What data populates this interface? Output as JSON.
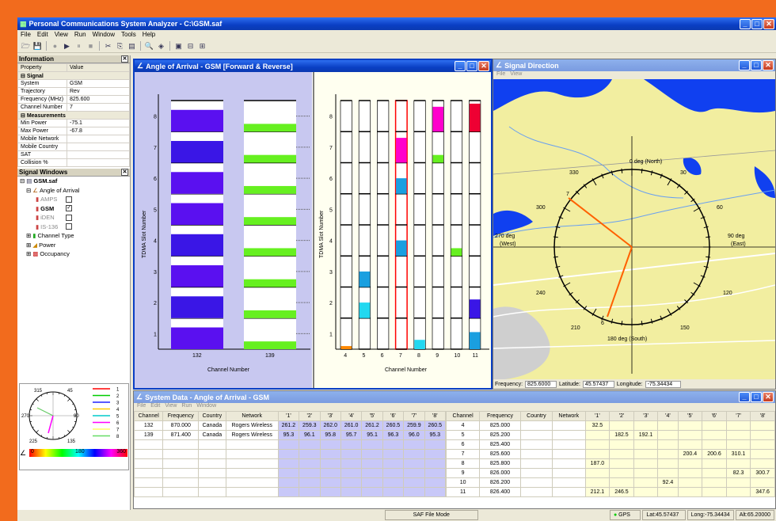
{
  "app": {
    "title": "Personal Communications System Analyzer - C:\\GSM.saf",
    "menu": [
      "File",
      "Edit",
      "View",
      "Run",
      "Window",
      "Tools",
      "Help"
    ]
  },
  "toolbar": {
    "icons": [
      "open-icon",
      "save-icon",
      "record-icon",
      "play-icon",
      "pause-icon",
      "stop-icon",
      "tools-icon",
      "copy-icon",
      "table-icon",
      "zoom-icon",
      "cube-icon",
      "layout-single-icon",
      "layout-split-icon",
      "layout-stack-icon"
    ]
  },
  "info": {
    "title": "Information",
    "header": [
      "Property",
      "Value"
    ],
    "signal_group": "Signal",
    "signal_rows": [
      [
        "System",
        "GSM"
      ],
      [
        "Trajectory",
        "Rev"
      ],
      [
        "Frequency (MHz)",
        "825.600"
      ],
      [
        "Channel Number",
        "7"
      ]
    ],
    "meas_group": "Measurements",
    "meas_rows": [
      [
        "Min Power",
        "-75.1"
      ],
      [
        "Max Power",
        "-67.8"
      ],
      [
        "Mobile Network",
        ""
      ],
      [
        "Mobile Country",
        ""
      ],
      [
        "SAT",
        ""
      ],
      [
        "Collision %",
        ""
      ]
    ]
  },
  "signal_windows": {
    "title": "Signal Windows",
    "root": "GSM.saf",
    "aoa": "Angle of Arrival",
    "items": [
      {
        "label": "AMPS",
        "checked": false
      },
      {
        "label": "GSM",
        "checked": true
      },
      {
        "label": "iDEN",
        "checked": false
      },
      {
        "label": "IS-136",
        "checked": false
      }
    ],
    "others": [
      "Channel Type",
      "Power",
      "Occupancy"
    ]
  },
  "mini_compass": {
    "labels": [
      "315",
      "45",
      "270",
      "90",
      "225",
      "135"
    ],
    "legend": [
      "1",
      "2",
      "3",
      "4",
      "5",
      "6",
      "7",
      "8"
    ],
    "legend_colors": [
      "#ff0000",
      "#00cc00",
      "#2222ff",
      "#ffcc00",
      "#00cccc",
      "#ff00ff",
      "#ffff66",
      "#66dd66"
    ],
    "scale": [
      "0",
      "180",
      "360"
    ]
  },
  "aoa_window": {
    "title": "Angle of Arrival - GSM [Forward & Reverse]",
    "ylabel": "TDMA Slot Number",
    "xlabel": "Channel Number"
  },
  "chart_data": [
    {
      "type": "bar",
      "title": "",
      "xlabel": "Channel Number",
      "ylabel": "TDMA Slot Number",
      "categories": [
        "132",
        "139"
      ],
      "y_ticks": [
        "1",
        "2",
        "3",
        "4",
        "5",
        "6",
        "7",
        "8"
      ],
      "slot_colors": {
        "132": [
          "#5a10f0",
          "#3a16e6",
          "#5a10f0",
          "#3a16e6",
          "#5a10f0",
          "#5a10f0",
          "#3a16e6",
          "#5a10f0"
        ],
        "139": [
          "#66f020",
          "#66f020",
          "#66f020",
          "#66f020",
          "#66f020",
          "#66f020",
          "#66f020",
          "#66f020"
        ]
      }
    },
    {
      "type": "bar",
      "title": "",
      "xlabel": "Channel Number",
      "ylabel": "TDMA Slot Number",
      "categories": [
        "4",
        "5",
        "6",
        "7",
        "8",
        "9",
        "10",
        "11"
      ],
      "y_ticks": [
        "1",
        "2",
        "3",
        "4",
        "5",
        "6",
        "7",
        "8"
      ],
      "filled_slots": [
        {
          "channel": "4",
          "slot": 1,
          "color": "#ff8800",
          "level": 0.1
        },
        {
          "channel": "5",
          "slot": 2,
          "color": "#22d8f0",
          "level": 0.5
        },
        {
          "channel": "5",
          "slot": 3,
          "color": "#1a9fe0",
          "level": 0.5
        },
        {
          "channel": "7",
          "slot": 4,
          "color": "#1a9fe0",
          "level": 0.5
        },
        {
          "channel": "7",
          "slot": 6,
          "color": "#1a9fe0",
          "level": 0.5
        },
        {
          "channel": "7",
          "slot": 7,
          "color": "#ff00cc",
          "level": 0.8
        },
        {
          "channel": "8",
          "slot": 1,
          "color": "#22d8f0",
          "level": 0.3
        },
        {
          "channel": "9",
          "slot": 7,
          "color": "#66f020",
          "level": 0.25
        },
        {
          "channel": "9",
          "slot": 8,
          "color": "#ff00cc",
          "level": 0.8
        },
        {
          "channel": "10",
          "slot": 4,
          "color": "#66f020",
          "level": 0.25
        },
        {
          "channel": "11",
          "slot": 1,
          "color": "#1a9fe0",
          "level": 0.55
        },
        {
          "channel": "11",
          "slot": 2,
          "color": "#3a16e6",
          "level": 0.6
        },
        {
          "channel": "11",
          "slot": 8,
          "color": "#ee0033",
          "level": 0.9
        }
      ],
      "highlighted_channel": "7"
    }
  ],
  "sigdir": {
    "title": "Signal Direction",
    "menu": [
      "File",
      "View"
    ],
    "labels": {
      "n": "0 deg (North)",
      "e1": "90 deg",
      "e2": "(East)",
      "w1": "270 deg",
      "w2": "(West)",
      "s": "180 deg (South)"
    },
    "ticks": [
      "330",
      "30",
      "300",
      "60",
      "240",
      "120",
      "210",
      "150"
    ],
    "line_labels": [
      "7",
      "6"
    ],
    "status": {
      "freq_label": "Frequency:",
      "freq": "825.6000",
      "lat_label": "Latitude:",
      "lat": "45.57437",
      "lon_label": "Longitude:",
      "lon": "-75.34434"
    }
  },
  "sysdata": {
    "title": "System Data - Angle of Arrival - GSM",
    "menu": [
      "File",
      "Edit",
      "View",
      "Run",
      "Window"
    ],
    "left_headers": [
      "Channel",
      "Frequency",
      "Country",
      "Network",
      "'1'",
      "'2'",
      "'3'",
      "'4'",
      "'5'",
      "'6'",
      "'7'",
      "'8'"
    ],
    "left_rows": [
      [
        "132",
        "870.000",
        "Canada",
        "Rogers Wireless",
        "261.2",
        "259.3",
        "262.0",
        "261.0",
        "261.2",
        "260.5",
        "259.9",
        "260.5"
      ],
      [
        "139",
        "871.400",
        "Canada",
        "Rogers Wireless",
        "95.3",
        "96.1",
        "95.8",
        "95.7",
        "95.1",
        "96.3",
        "96.0",
        "95.3"
      ]
    ],
    "right_headers": [
      "Channel",
      "Frequency",
      "Country",
      "Network",
      "'1'",
      "'2'",
      "'3'",
      "'4'",
      "'5'",
      "'6'",
      "'7'",
      "'8'"
    ],
    "right_rows": [
      [
        "4",
        "825.000",
        "",
        "",
        "32.5",
        "",
        "",
        "",
        "",
        "",
        "",
        ""
      ],
      [
        "5",
        "825.200",
        "",
        "",
        "",
        "182.5",
        "192.1",
        "",
        "",
        "",
        "",
        ""
      ],
      [
        "6",
        "825.400",
        "",
        "",
        "",
        "",
        "",
        "",
        "",
        "",
        "",
        ""
      ],
      [
        "7",
        "825.600",
        "",
        "",
        "",
        "",
        "",
        "",
        "200.4",
        "200.6",
        "310.1",
        ""
      ],
      [
        "8",
        "825.800",
        "",
        "",
        "187.0",
        "",
        "",
        "",
        "",
        "",
        "",
        ""
      ],
      [
        "9",
        "826.000",
        "",
        "",
        "",
        "",
        "",
        "",
        "",
        "",
        "82.3",
        "300.7"
      ],
      [
        "10",
        "826.200",
        "",
        "",
        "",
        "",
        "",
        "92.4",
        "",
        "",
        "",
        ""
      ],
      [
        "11",
        "826.400",
        "",
        "",
        "212.1",
        "246.5",
        "",
        "",
        "",
        "",
        "",
        "347.6"
      ]
    ]
  },
  "status": {
    "mode": "SAF File Mode",
    "gps": "GPS",
    "lat": "Lat:45.57437",
    "long": "Long:-75.34434",
    "alt": "Alt:65.20000"
  }
}
